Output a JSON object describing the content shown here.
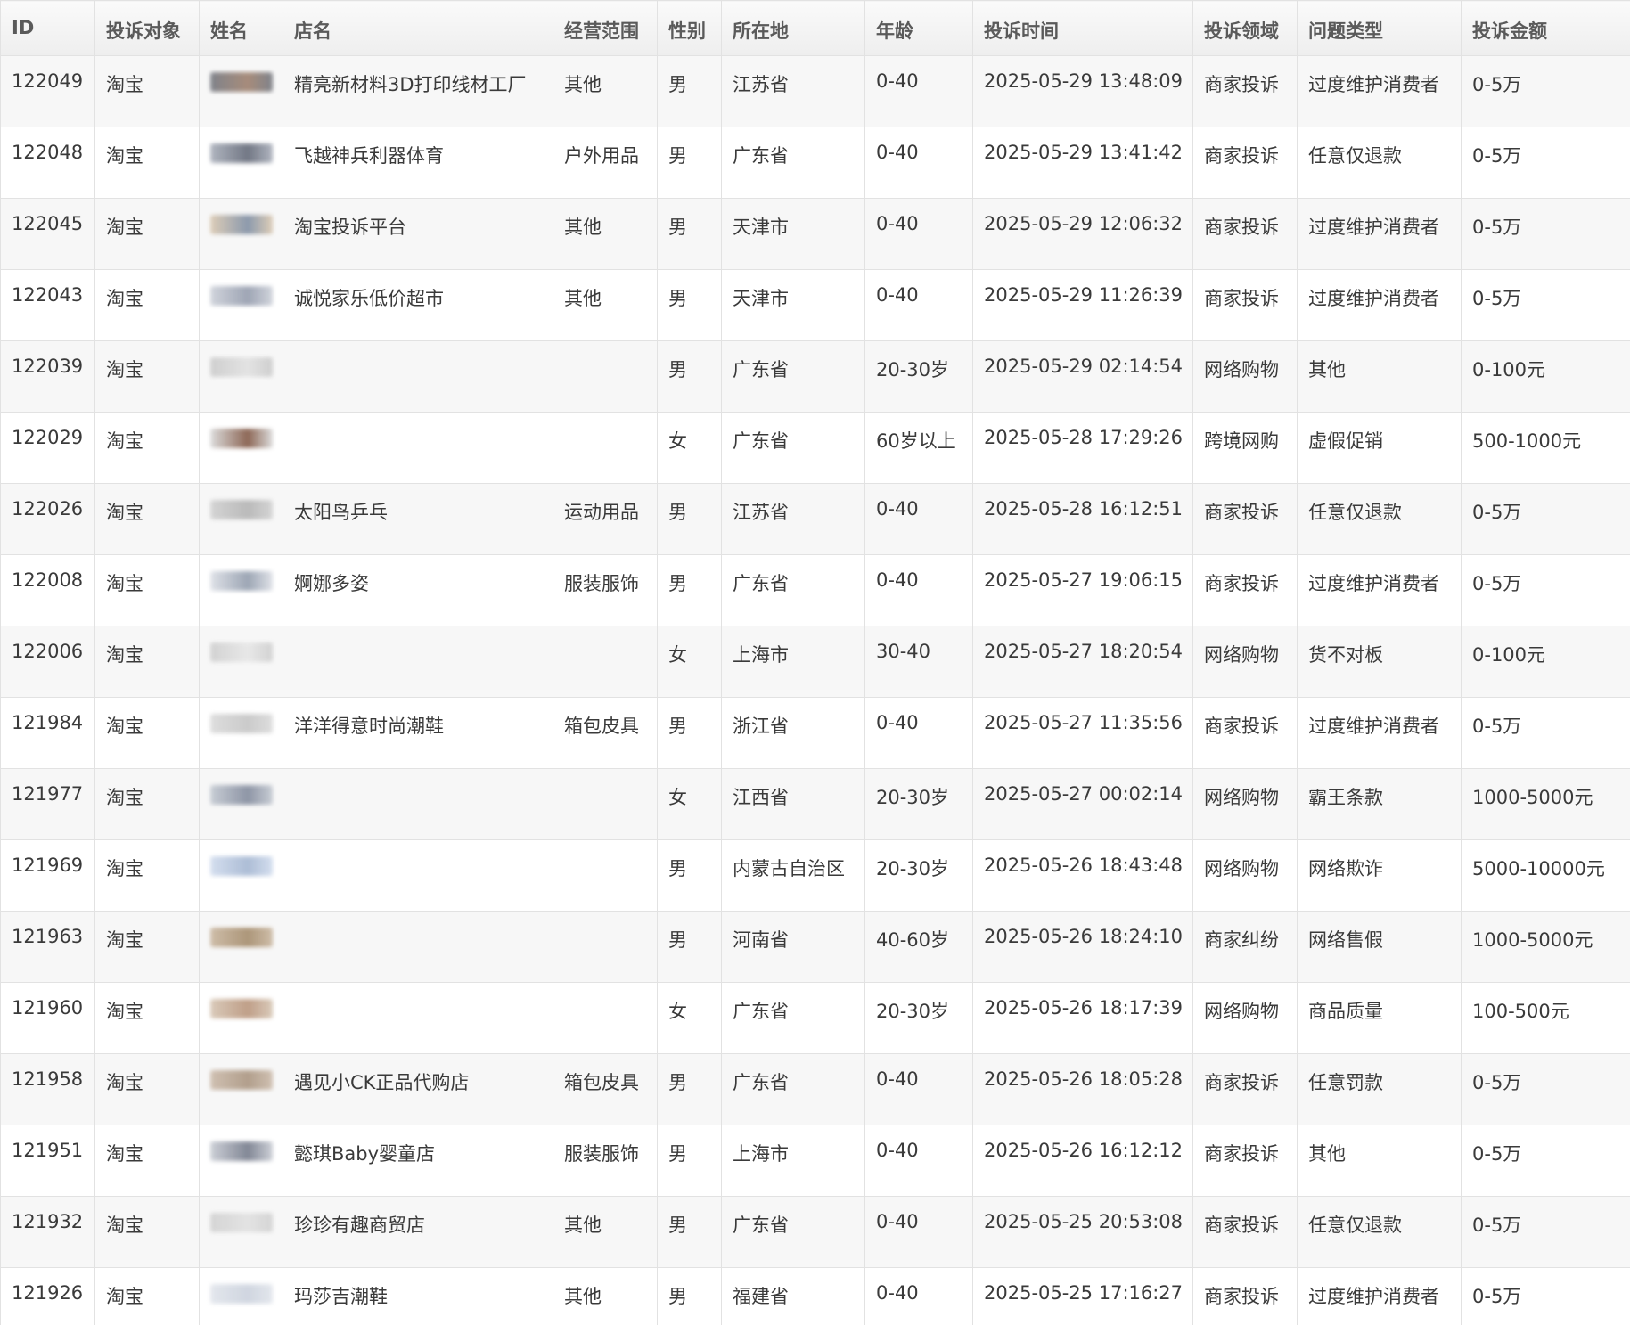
{
  "columns": [
    "ID",
    "投诉对象",
    "姓名",
    "店名",
    "经营范围",
    "性别",
    "所在地",
    "年龄",
    "投诉时间",
    "投诉领域",
    "问题类型",
    "投诉金额"
  ],
  "blur_colors": {
    "a": [
      "#6b6f78",
      "#9a7a66"
    ],
    "b": [
      "#a3a9b5",
      "#5a6070"
    ],
    "c": [
      "#d9c6ad",
      "#7a8aa0"
    ],
    "d": [
      "#c9cdd6",
      "#8e96a8"
    ],
    "e": [
      "#c8c8c8",
      "#e0e0e0"
    ],
    "f": [
      "#d6d6d6",
      "#7a4e3a"
    ],
    "g": [
      "#cfcfcf",
      "#b0b0b0"
    ],
    "h": [
      "#dadde4",
      "#8c97a8"
    ],
    "i": [
      "#cccccc",
      "#e6e6e6"
    ],
    "j": [
      "#d8d8d8",
      "#c2c2c2"
    ],
    "k": [
      "#c0c6cf",
      "#7c8598"
    ],
    "l": [
      "#cdd9ec",
      "#9fb2cf"
    ],
    "m": [
      "#c7b39b",
      "#a08664"
    ],
    "n": [
      "#d3c1ae",
      "#b58f74"
    ],
    "o": [
      "#c9b7a6",
      "#a6907a"
    ],
    "p": [
      "#c4c8d0",
      "#6d7384"
    ],
    "q": [
      "#cfcfcf",
      "#e0e0e0"
    ],
    "r": [
      "#dfe3ea",
      "#c8cfdb"
    ]
  },
  "rows": [
    {
      "id": "122049",
      "target": "淘宝",
      "blur": "a",
      "shop": "精亮新材料3D打印线材工厂",
      "scope": "其他",
      "gender": "男",
      "location": "江苏省",
      "age": "0-40",
      "time": "2025-05-29 13:48:09",
      "field": "商家投诉",
      "issue": "过度维护消费者",
      "amount": "0-5万"
    },
    {
      "id": "122048",
      "target": "淘宝",
      "blur": "b",
      "shop": "飞越神兵利器体育",
      "scope": "户外用品",
      "gender": "男",
      "location": "广东省",
      "age": "0-40",
      "time": "2025-05-29 13:41:42",
      "field": "商家投诉",
      "issue": "任意仅退款",
      "amount": "0-5万"
    },
    {
      "id": "122045",
      "target": "淘宝",
      "blur": "c",
      "shop": "淘宝投诉平台",
      "scope": "其他",
      "gender": "男",
      "location": "天津市",
      "age": "0-40",
      "time": "2025-05-29 12:06:32",
      "field": "商家投诉",
      "issue": "过度维护消费者",
      "amount": "0-5万"
    },
    {
      "id": "122043",
      "target": "淘宝",
      "blur": "d",
      "shop": "诚悦家乐低价超市",
      "scope": "其他",
      "gender": "男",
      "location": "天津市",
      "age": "0-40",
      "time": "2025-05-29 11:26:39",
      "field": "商家投诉",
      "issue": "过度维护消费者",
      "amount": "0-5万"
    },
    {
      "id": "122039",
      "target": "淘宝",
      "blur": "e",
      "shop": "",
      "scope": "",
      "gender": "男",
      "location": "广东省",
      "age": "20-30岁",
      "time": "2025-05-29 02:14:54",
      "field": "网络购物",
      "issue": "其他",
      "amount": "0-100元"
    },
    {
      "id": "122029",
      "target": "淘宝",
      "blur": "f",
      "shop": "",
      "scope": "",
      "gender": "女",
      "location": "广东省",
      "age": "60岁以上",
      "time": "2025-05-28 17:29:26",
      "field": "跨境网购",
      "issue": "虚假促销",
      "amount": "500-1000元"
    },
    {
      "id": "122026",
      "target": "淘宝",
      "blur": "g",
      "shop": "太阳鸟乒乓",
      "scope": "运动用品",
      "gender": "男",
      "location": "江苏省",
      "age": "0-40",
      "time": "2025-05-28 16:12:51",
      "field": "商家投诉",
      "issue": "任意仅退款",
      "amount": "0-5万"
    },
    {
      "id": "122008",
      "target": "淘宝",
      "blur": "h",
      "shop": "婀娜多姿",
      "scope": "服装服饰",
      "gender": "男",
      "location": "广东省",
      "age": "0-40",
      "time": "2025-05-27 19:06:15",
      "field": "商家投诉",
      "issue": "过度维护消费者",
      "amount": "0-5万"
    },
    {
      "id": "122006",
      "target": "淘宝",
      "blur": "i",
      "shop": "",
      "scope": "",
      "gender": "女",
      "location": "上海市",
      "age": "30-40",
      "time": "2025-05-27 18:20:54",
      "field": "网络购物",
      "issue": "货不对板",
      "amount": "0-100元"
    },
    {
      "id": "121984",
      "target": "淘宝",
      "blur": "j",
      "shop": "洋洋得意时尚潮鞋",
      "scope": "箱包皮具",
      "gender": "男",
      "location": "浙江省",
      "age": "0-40",
      "time": "2025-05-27 11:35:56",
      "field": "商家投诉",
      "issue": "过度维护消费者",
      "amount": "0-5万"
    },
    {
      "id": "121977",
      "target": "淘宝",
      "blur": "k",
      "shop": "",
      "scope": "",
      "gender": "女",
      "location": "江西省",
      "age": "20-30岁",
      "time": "2025-05-27 00:02:14",
      "field": "网络购物",
      "issue": "霸王条款",
      "amount": "1000-5000元"
    },
    {
      "id": "121969",
      "target": "淘宝",
      "blur": "l",
      "shop": "",
      "scope": "",
      "gender": "男",
      "location": "内蒙古自治区",
      "age": "20-30岁",
      "time": "2025-05-26 18:43:48",
      "field": "网络购物",
      "issue": "网络欺诈",
      "amount": "5000-10000元"
    },
    {
      "id": "121963",
      "target": "淘宝",
      "blur": "m",
      "shop": "",
      "scope": "",
      "gender": "男",
      "location": "河南省",
      "age": "40-60岁",
      "time": "2025-05-26 18:24:10",
      "field": "商家纠纷",
      "issue": "网络售假",
      "amount": "1000-5000元"
    },
    {
      "id": "121960",
      "target": "淘宝",
      "blur": "n",
      "shop": "",
      "scope": "",
      "gender": "女",
      "location": "广东省",
      "age": "20-30岁",
      "time": "2025-05-26 18:17:39",
      "field": "网络购物",
      "issue": "商品质量",
      "amount": "100-500元"
    },
    {
      "id": "121958",
      "target": "淘宝",
      "blur": "o",
      "shop": "遇见小CK正品代购店",
      "scope": "箱包皮具",
      "gender": "男",
      "location": "广东省",
      "age": "0-40",
      "time": "2025-05-26 18:05:28",
      "field": "商家投诉",
      "issue": "任意罚款",
      "amount": "0-5万"
    },
    {
      "id": "121951",
      "target": "淘宝",
      "blur": "p",
      "shop": "懿琪Baby婴童店",
      "scope": "服装服饰",
      "gender": "男",
      "location": "上海市",
      "age": "0-40",
      "time": "2025-05-26 16:12:12",
      "field": "商家投诉",
      "issue": "其他",
      "amount": "0-5万"
    },
    {
      "id": "121932",
      "target": "淘宝",
      "blur": "q",
      "shop": "珍珍有趣商贸店",
      "scope": "其他",
      "gender": "男",
      "location": "广东省",
      "age": "0-40",
      "time": "2025-05-25 20:53:08",
      "field": "商家投诉",
      "issue": "任意仅退款",
      "amount": "0-5万"
    },
    {
      "id": "121926",
      "target": "淘宝",
      "blur": "r",
      "shop": "玛莎吉潮鞋",
      "scope": "其他",
      "gender": "男",
      "location": "福建省",
      "age": "0-40",
      "time": "2025-05-25 17:16:27",
      "field": "商家投诉",
      "issue": "过度维护消费者",
      "amount": "0-5万"
    }
  ]
}
